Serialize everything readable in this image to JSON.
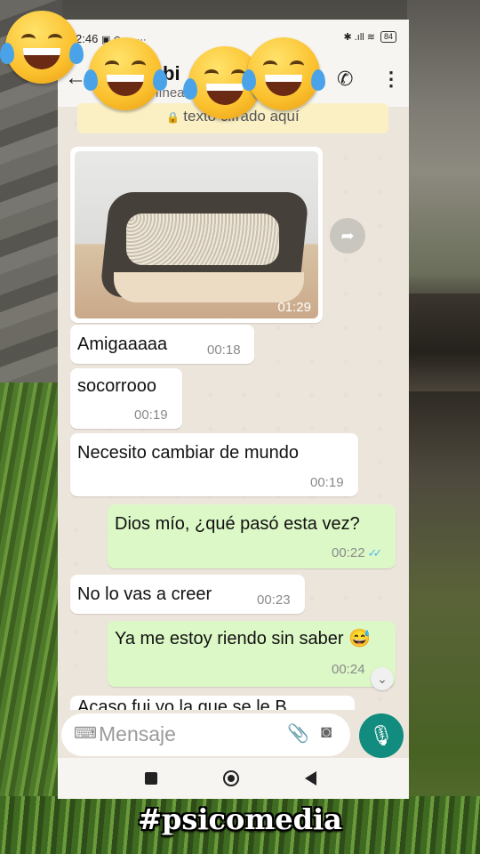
{
  "status_bar": {
    "time": "2:46",
    "icons_left": "▣ ⊜ ☁ ···",
    "battery": "84",
    "icons_right": "✱ .ıll ≋"
  },
  "header": {
    "name": "bi",
    "status": "línea",
    "back_icon": "arrow-left",
    "call_icon": "phone",
    "menu_icon": "more-vert"
  },
  "encrypted_banner": {
    "text": "texto cifrado aquí"
  },
  "image_message": {
    "time": "01:29"
  },
  "messages": [
    {
      "direction": "in",
      "text": "Amigaaaaa",
      "time": "00:18"
    },
    {
      "direction": "in",
      "text": "socorrooo",
      "time": "00:19"
    },
    {
      "direction": "in",
      "text": "Necesito cambiar de mundo",
      "time": "00:19"
    },
    {
      "direction": "out",
      "text": "Dios mío, ¿qué pasó esta vez?",
      "time": "00:22"
    },
    {
      "direction": "in",
      "text": "No lo vas a creer",
      "time": "00:23"
    },
    {
      "direction": "out",
      "text": "Ya me estoy riendo sin saber 😅",
      "time": "00:24"
    }
  ],
  "cutoff_message": {
    "text": "Acaso fui yo la que se le B..."
  },
  "input": {
    "placeholder": "Mensaje"
  },
  "watermark": "#psicomedia",
  "colors": {
    "incoming": "#ffffff",
    "outgoing": "#dcf8c6",
    "accent": "#128c7e",
    "read_ticks": "#53bdeb"
  }
}
